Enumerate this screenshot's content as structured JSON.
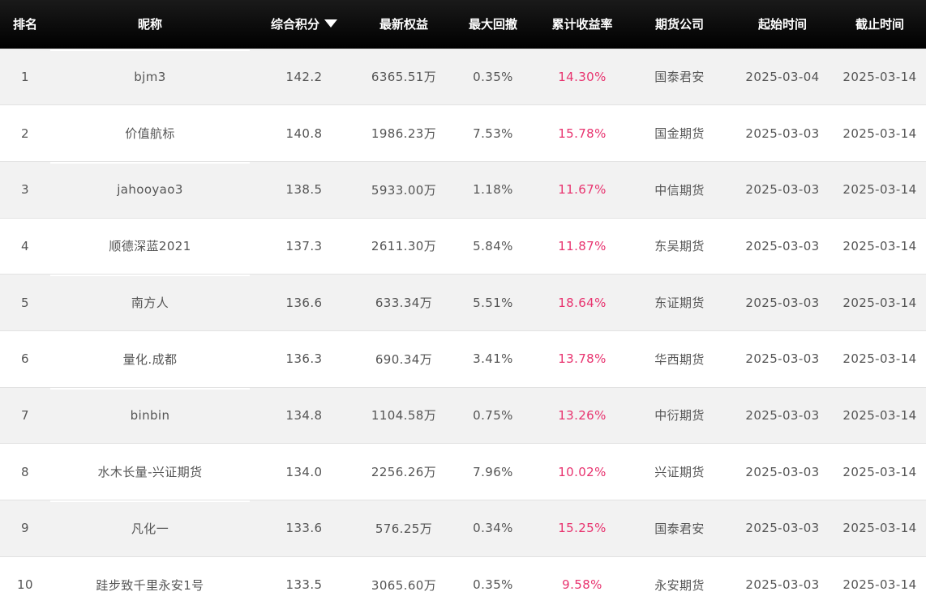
{
  "headers": {
    "rank": "排名",
    "nickname": "昵称",
    "score": "综合积分",
    "equity": "最新权益",
    "drawdown": "最大回撤",
    "return_rate": "累计收益率",
    "company": "期货公司",
    "start_date": "起始时间",
    "end_date": "截止时间"
  },
  "sort_icon": "triangle-down-icon",
  "colors": {
    "header_bg": "#000000",
    "rate_text": "#e8336f",
    "row_alt": "#f2f2f2"
  },
  "rows": [
    {
      "rank": "1",
      "nickname": "bjm3",
      "score": "142.2",
      "equity": "6365.51万",
      "drawdown": "0.35%",
      "return_rate": "14.30%",
      "company": "国泰君安",
      "start_date": "2025-03-04",
      "end_date": "2025-03-14"
    },
    {
      "rank": "2",
      "nickname": "价值航标",
      "score": "140.8",
      "equity": "1986.23万",
      "drawdown": "7.53%",
      "return_rate": "15.78%",
      "company": "国金期货",
      "start_date": "2025-03-03",
      "end_date": "2025-03-14"
    },
    {
      "rank": "3",
      "nickname": "jahooyao3",
      "score": "138.5",
      "equity": "5933.00万",
      "drawdown": "1.18%",
      "return_rate": "11.67%",
      "company": "中信期货",
      "start_date": "2025-03-03",
      "end_date": "2025-03-14"
    },
    {
      "rank": "4",
      "nickname": "顺德深蓝2021",
      "score": "137.3",
      "equity": "2611.30万",
      "drawdown": "5.84%",
      "return_rate": "11.87%",
      "company": "东吴期货",
      "start_date": "2025-03-03",
      "end_date": "2025-03-14"
    },
    {
      "rank": "5",
      "nickname": "南方人",
      "score": "136.6",
      "equity": "633.34万",
      "drawdown": "5.51%",
      "return_rate": "18.64%",
      "company": "东证期货",
      "start_date": "2025-03-03",
      "end_date": "2025-03-14"
    },
    {
      "rank": "6",
      "nickname": "量化.成都",
      "score": "136.3",
      "equity": "690.34万",
      "drawdown": "3.41%",
      "return_rate": "13.78%",
      "company": "华西期货",
      "start_date": "2025-03-03",
      "end_date": "2025-03-14"
    },
    {
      "rank": "7",
      "nickname": "binbin",
      "score": "134.8",
      "equity": "1104.58万",
      "drawdown": "0.75%",
      "return_rate": "13.26%",
      "company": "中衍期货",
      "start_date": "2025-03-03",
      "end_date": "2025-03-14"
    },
    {
      "rank": "8",
      "nickname": "水木长量-兴证期货",
      "score": "134.0",
      "equity": "2256.26万",
      "drawdown": "7.96%",
      "return_rate": "10.02%",
      "company": "兴证期货",
      "start_date": "2025-03-03",
      "end_date": "2025-03-14"
    },
    {
      "rank": "9",
      "nickname": "凡化一",
      "score": "133.6",
      "equity": "576.25万",
      "drawdown": "0.34%",
      "return_rate": "15.25%",
      "company": "国泰君安",
      "start_date": "2025-03-03",
      "end_date": "2025-03-14"
    },
    {
      "rank": "10",
      "nickname": "跬步致千里永安1号",
      "score": "133.5",
      "equity": "3065.60万",
      "drawdown": "0.35%",
      "return_rate": "9.58%",
      "company": "永安期货",
      "start_date": "2025-03-03",
      "end_date": "2025-03-14"
    }
  ]
}
